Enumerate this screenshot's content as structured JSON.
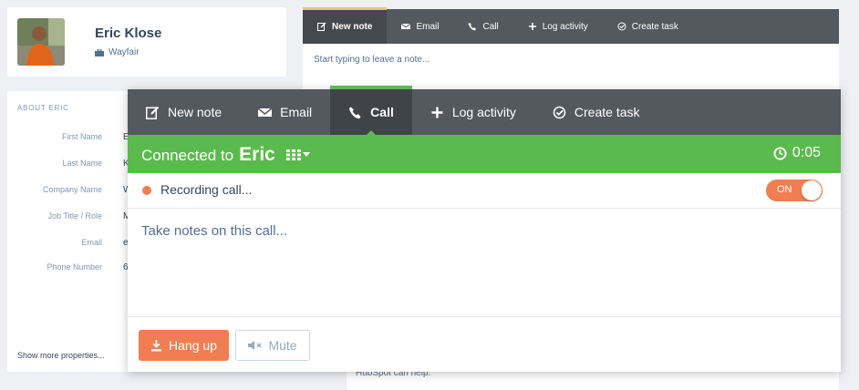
{
  "contact": {
    "name": "Eric Klose",
    "company": "Wayfair"
  },
  "about": {
    "title": "ABOUT ERIC",
    "properties": [
      {
        "label": "First Name",
        "value": "E"
      },
      {
        "label": "Last Name",
        "value": "K"
      },
      {
        "label": "Company Name",
        "value": "W"
      },
      {
        "label": "Job Title / Role",
        "value": "M"
      },
      {
        "label": "Email",
        "value": "e"
      },
      {
        "label": "Phone Number",
        "value": "6"
      }
    ],
    "show_more": "Show more properties..."
  },
  "background_editor": {
    "tabs": [
      {
        "label": "New note",
        "icon": "edit-icon"
      },
      {
        "label": "Email",
        "icon": "envelope-icon"
      },
      {
        "label": "Call",
        "icon": "phone-icon"
      },
      {
        "label": "Log activity",
        "icon": "plus-icon"
      },
      {
        "label": "Create task",
        "icon": "check-circle-icon"
      }
    ],
    "active_tab": "New note",
    "placeholder": "Start typing to leave a note...",
    "footer_text": "HubSpot can help."
  },
  "call_panel": {
    "tabs": [
      {
        "label": "New note",
        "icon": "edit-icon"
      },
      {
        "label": "Email",
        "icon": "envelope-icon"
      },
      {
        "label": "Call",
        "icon": "phone-icon"
      },
      {
        "label": "Log activity",
        "icon": "plus-icon"
      },
      {
        "label": "Create task",
        "icon": "check-circle-icon"
      }
    ],
    "active_tab": "Call",
    "connected_prefix": "Connected to",
    "connected_name": "Eric",
    "timer": "0:05",
    "recording_text": "Recording call...",
    "recording_toggle": "ON",
    "notes_placeholder": "Take notes on this call...",
    "hangup_label": "Hang up",
    "mute_label": "Mute"
  },
  "colors": {
    "tab_bar": "#54595f",
    "connected_green": "#5bba4d",
    "accent_orange": "#f07e52",
    "active_tab_top_bg_editor": "#f5c26b"
  }
}
